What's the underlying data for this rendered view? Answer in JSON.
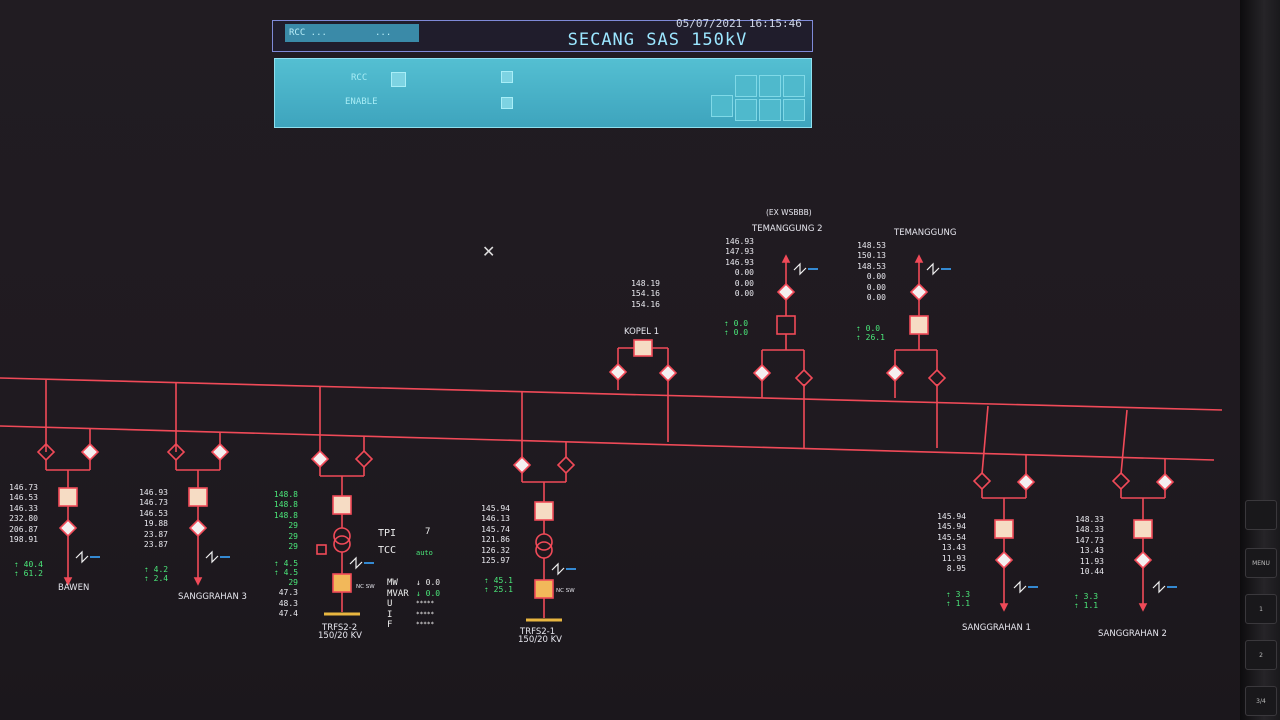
{
  "header": {
    "title": "SECANG SAS 150kV",
    "datetime": "05/07/2021 16:15:46",
    "pill_left": "RCC ...",
    "pill_right": "...",
    "panel_rcc": "RCC",
    "panel_enable": "ENABLE"
  },
  "busbars": {
    "color": "#f04a58"
  },
  "bays": [
    {
      "name": "BAWEN",
      "values": [
        "146.73",
        "146.53",
        "146.33",
        "232.80",
        "206.87",
        "198.91"
      ],
      "status": [
        "40.4",
        "61.2"
      ]
    },
    {
      "name": "SANGGRAHAN 3",
      "values": [
        "146.93",
        "146.73",
        "146.53",
        "19.88",
        "23.87",
        "23.87"
      ],
      "status": [
        "4.2",
        "2.4"
      ]
    },
    {
      "name": "TRFS2-2",
      "rating": "150/20 KV",
      "values": [
        "148.8",
        "148.8",
        "148.8",
        "29",
        "29",
        "29"
      ],
      "status": [
        "4.5",
        "4.5"
      ],
      "low_values": [
        "29",
        "47.3",
        "48.3",
        "47.4"
      ]
    },
    {
      "name": "TRFS2-1",
      "rating": "150/20 KV",
      "values": [
        "145.94",
        "146.13",
        "145.74",
        "121.86",
        "126.32",
        "125.97"
      ],
      "status": [
        "45.1",
        "25.1"
      ]
    },
    {
      "name": "KOPEL 1",
      "values": [
        "148.19",
        "154.16",
        "154.16"
      ]
    },
    {
      "name": "TEMANGGUNG 2",
      "note": "(EX WSBBB)",
      "values": [
        "146.93",
        "147.93",
        "146.93",
        "0.00",
        "0.00",
        "0.00"
      ],
      "status": [
        "0.0",
        "0.0"
      ]
    },
    {
      "name": "TEMANGGUNG",
      "values": [
        "148.53",
        "150.13",
        "148.53",
        "0.00",
        "0.00",
        "0.00"
      ],
      "status": [
        "0.0",
        "26.1"
      ]
    },
    {
      "name": "SANGGRAHAN 1",
      "values": [
        "145.94",
        "145.94",
        "145.54",
        "13.43",
        "11.93",
        "8.95"
      ],
      "status": [
        "3.3",
        "1.1"
      ]
    },
    {
      "name": "SANGGRAHAN 2",
      "values": [
        "148.33",
        "148.33",
        "147.73",
        "13.43",
        "11.93",
        "10.44"
      ],
      "status": [
        "3.3",
        "1.1"
      ]
    }
  ],
  "tap": {
    "tpi_label": "TPI",
    "tpi_value": "7",
    "tcc_label": "TCC",
    "tcc_value": "auto",
    "rows": [
      {
        "label": "MW",
        "value": "0.0"
      },
      {
        "label": "MVAR",
        "value": "0.0"
      },
      {
        "label": "U",
        "value": "*****"
      },
      {
        "label": "I",
        "value": "*****"
      },
      {
        "label": "F",
        "value": "*****"
      }
    ]
  },
  "misc": {
    "nc_label": "NC SW",
    "cursor": "✕"
  },
  "bezel": {
    "buttons": [
      "MENU",
      "1",
      "2",
      "3/4"
    ]
  }
}
